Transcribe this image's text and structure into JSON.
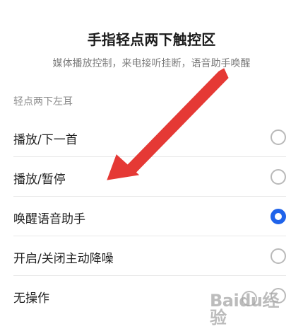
{
  "header": {
    "title": "手指轻点两下触控区",
    "subtitle": "媒体播放控制，来电接听挂断，语音助手唤醒"
  },
  "section": {
    "label": "轻点两下左耳"
  },
  "options": [
    {
      "label": "播放/下一首",
      "selected": false
    },
    {
      "label": "播放/暂停",
      "selected": false
    },
    {
      "label": "唤醒语音助手",
      "selected": true
    },
    {
      "label": "开启/关闭主动降噪",
      "selected": false
    },
    {
      "label": "无操作",
      "selected": false
    }
  ],
  "colors": {
    "accent": "#1f63ea",
    "arrow": "#e53935"
  },
  "watermark": {
    "text": "Baidu经验"
  },
  "icons": {
    "radio_unselected": "radio-unselected-icon",
    "radio_selected": "radio-selected-icon",
    "annotation_arrow": "annotation-arrow"
  }
}
